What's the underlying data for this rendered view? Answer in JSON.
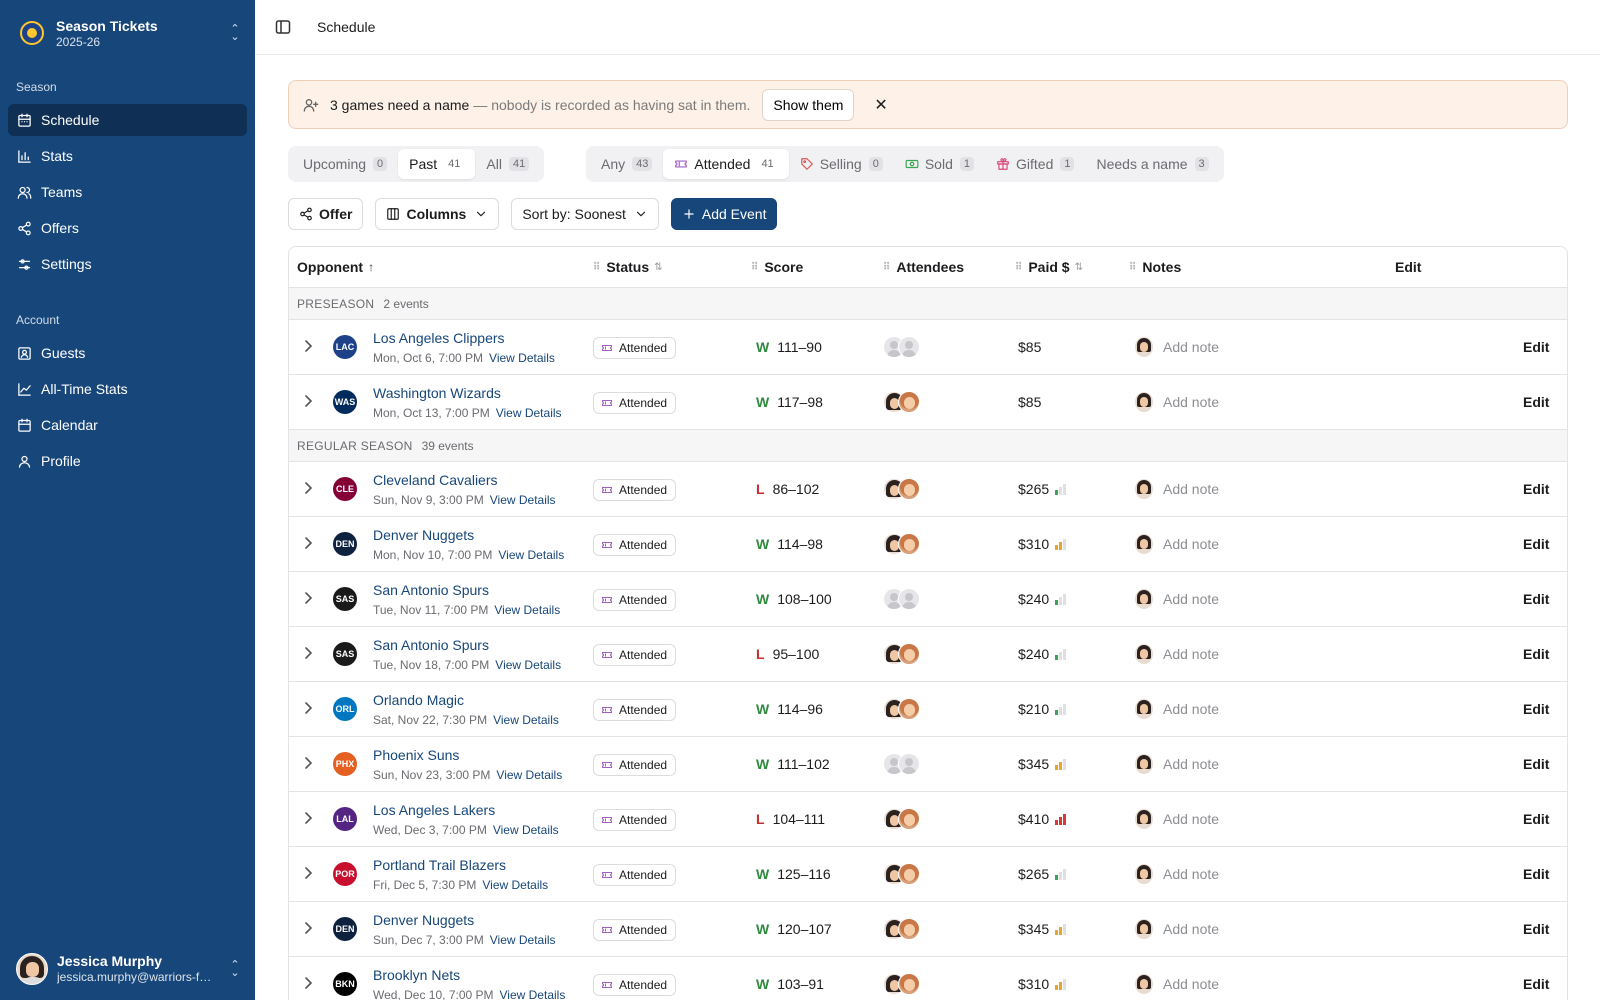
{
  "sidebar": {
    "app_title": "Season Tickets",
    "app_subtitle": "2025-26",
    "section_season": "Season",
    "section_account": "Account",
    "season_items": [
      {
        "label": "Schedule",
        "icon": "calendar-grid-icon",
        "active": true
      },
      {
        "label": "Stats",
        "icon": "bar-chart-icon"
      },
      {
        "label": "Teams",
        "icon": "users-icon"
      },
      {
        "label": "Offers",
        "icon": "share-icon"
      },
      {
        "label": "Settings",
        "icon": "sliders-icon"
      }
    ],
    "account_items": [
      {
        "label": "Guests",
        "icon": "contact-icon"
      },
      {
        "label": "All-Time Stats",
        "icon": "line-chart-icon"
      },
      {
        "label": "Calendar",
        "icon": "calendar-icon"
      },
      {
        "label": "Profile",
        "icon": "user-icon"
      }
    ],
    "user": {
      "name": "Jessica Murphy",
      "email": "jessica.murphy@warriors-fan.com"
    }
  },
  "topbar": {
    "title": "Schedule"
  },
  "alert": {
    "strong": "3 games need a name",
    "muted": "— nobody is recorded as having sat in them.",
    "button": "Show them"
  },
  "time_filter": [
    {
      "label": "Upcoming",
      "count": "0"
    },
    {
      "label": "Past",
      "count": "41",
      "active": true
    },
    {
      "label": "All",
      "count": "41"
    }
  ],
  "status_filter": [
    {
      "label": "Any",
      "count": "43"
    },
    {
      "label": "Attended",
      "count": "41",
      "active": true,
      "icon": "ticket-icon"
    },
    {
      "label": "Selling",
      "count": "0",
      "icon": "tag-icon"
    },
    {
      "label": "Sold",
      "count": "1",
      "icon": "cash-icon"
    },
    {
      "label": "Gifted",
      "count": "1",
      "icon": "gift-icon"
    },
    {
      "label": "Needs a name",
      "count": "3"
    }
  ],
  "toolbar": {
    "offer": "Offer",
    "columns": "Columns",
    "sort": "Sort by: Soonest",
    "add": "Add Event"
  },
  "table": {
    "columns": [
      "Opponent",
      "Status",
      "Score",
      "Attendees",
      "Paid $",
      "Notes",
      "Edit"
    ],
    "note_placeholder": "Add note",
    "view_details": "View Details",
    "edit": "Edit",
    "groups": [
      {
        "title": "PRESEASON",
        "count": "2 events",
        "rows": [
          {
            "opponent": "Los Angeles Clippers",
            "date": "Mon, Oct 6, 7:00 PM",
            "logo": "LAC",
            "logo_color": "#1d428a",
            "status": "Attended",
            "result": "W",
            "score": "111–90",
            "attendees": "empty",
            "paid": "$85",
            "demand": 0
          },
          {
            "opponent": "Washington Wizards",
            "date": "Mon, Oct 13, 7:00 PM",
            "logo": "WAS",
            "logo_color": "#002b5c",
            "status": "Attended",
            "result": "W",
            "score": "117–98",
            "attendees": "filled",
            "paid": "$85",
            "demand": 0
          }
        ]
      },
      {
        "title": "REGULAR SEASON",
        "count": "39 events",
        "rows": [
          {
            "opponent": "Cleveland Cavaliers",
            "date": "Sun, Nov 9, 3:00 PM",
            "logo": "CLE",
            "logo_color": "#860038",
            "status": "Attended",
            "result": "L",
            "score": "86–102",
            "attendees": "filled",
            "paid": "$265",
            "demand": 2
          },
          {
            "opponent": "Denver Nuggets",
            "date": "Mon, Nov 10, 7:00 PM",
            "logo": "DEN",
            "logo_color": "#0e2240",
            "status": "Attended",
            "result": "W",
            "score": "114–98",
            "attendees": "filled",
            "paid": "$310",
            "demand": 3
          },
          {
            "opponent": "San Antonio Spurs",
            "date": "Tue, Nov 11, 7:00 PM",
            "logo": "SAS",
            "logo_color": "#1a1a1a",
            "status": "Attended",
            "result": "W",
            "score": "108–100",
            "attendees": "empty",
            "paid": "$240",
            "demand": 2
          },
          {
            "opponent": "San Antonio Spurs",
            "date": "Tue, Nov 18, 7:00 PM",
            "logo": "SAS",
            "logo_color": "#1a1a1a",
            "status": "Attended",
            "result": "L",
            "score": "95–100",
            "attendees": "filled",
            "paid": "$240",
            "demand": 2
          },
          {
            "opponent": "Orlando Magic",
            "date": "Sat, Nov 22, 7:30 PM",
            "logo": "ORL",
            "logo_color": "#0077c0",
            "status": "Attended",
            "result": "W",
            "score": "114–96",
            "attendees": "filled",
            "paid": "$210",
            "demand": 1
          },
          {
            "opponent": "Phoenix Suns",
            "date": "Sun, Nov 23, 3:00 PM",
            "logo": "PHX",
            "logo_color": "#e56020",
            "status": "Attended",
            "result": "W",
            "score": "111–102",
            "attendees": "empty",
            "paid": "$345",
            "demand": 3
          },
          {
            "opponent": "Los Angeles Lakers",
            "date": "Wed, Dec 3, 7:00 PM",
            "logo": "LAL",
            "logo_color": "#552583",
            "status": "Attended",
            "result": "L",
            "score": "104–111",
            "attendees": "filled",
            "paid": "$410",
            "demand": 4
          },
          {
            "opponent": "Portland Trail Blazers",
            "date": "Fri, Dec 5, 7:30 PM",
            "logo": "POR",
            "logo_color": "#c8102e",
            "status": "Attended",
            "result": "W",
            "score": "125–116",
            "attendees": "filled",
            "paid": "$265",
            "demand": 2
          },
          {
            "opponent": "Denver Nuggets",
            "date": "Sun, Dec 7, 3:00 PM",
            "logo": "DEN",
            "logo_color": "#0e2240",
            "status": "Attended",
            "result": "W",
            "score": "120–107",
            "attendees": "filled",
            "paid": "$345",
            "demand": 3
          },
          {
            "opponent": "Brooklyn Nets",
            "date": "Wed, Dec 10, 7:00 PM",
            "logo": "BKN",
            "logo_color": "#000000",
            "status": "Attended",
            "result": "W",
            "score": "103–91",
            "attendees": "filled",
            "paid": "$310",
            "demand": 3
          }
        ]
      }
    ]
  },
  "colors": {
    "sidebar": "#17467a",
    "accent": "#17467a",
    "win": "#2e8b3e",
    "loss": "#c62f2f",
    "demand_low": "#3aa655",
    "demand_mid": "#e8a530",
    "demand_high": "#d93838"
  }
}
